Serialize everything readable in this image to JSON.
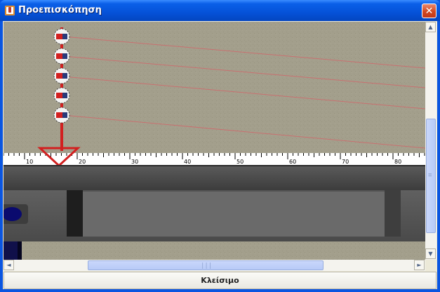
{
  "window": {
    "title": "Προεπισκόπηση",
    "close_glyph": "✕",
    "icon": "java-cup-icon"
  },
  "ruler": {
    "labels": [
      "10",
      "20",
      "30",
      "40",
      "50",
      "60",
      "70",
      "80"
    ]
  },
  "footer": {
    "close_button_label": "Κλείσιμο"
  },
  "scrollbars": {
    "vertical": {
      "up_glyph": "▲",
      "down_glyph": "▼",
      "grip_glyph": "≡"
    },
    "horizontal": {
      "left_glyph": "◄",
      "right_glyph": "►",
      "grip_glyph": "|||"
    }
  },
  "colors": {
    "title_bar": "#0552d8",
    "background_scene": "#a39f8c",
    "marker_red": "#d22020",
    "thread_line": "#c97070"
  }
}
